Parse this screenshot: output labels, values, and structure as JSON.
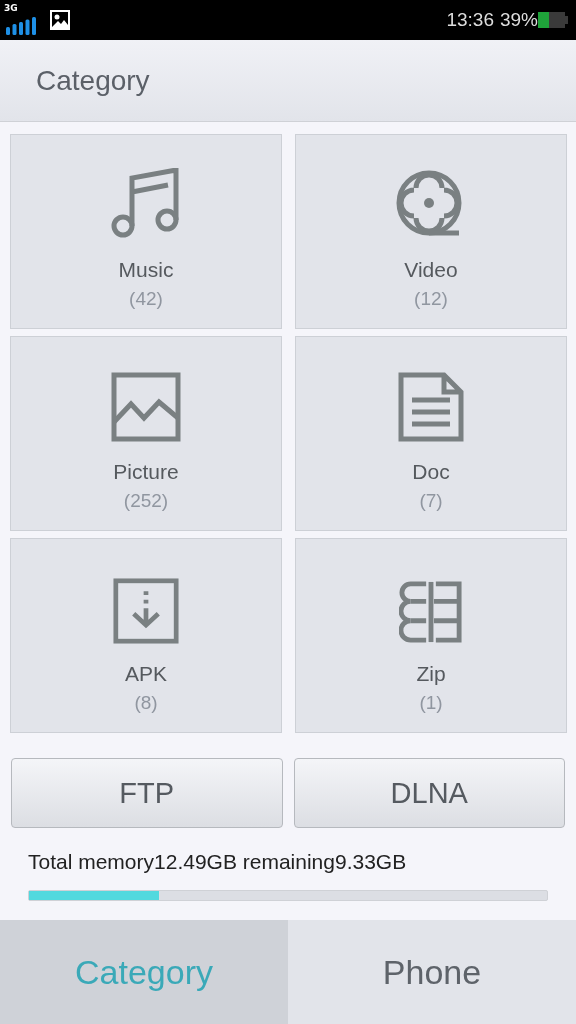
{
  "status_bar": {
    "network": "3G",
    "time": "13:36",
    "battery_text": "39%"
  },
  "header": {
    "title": "Category"
  },
  "categories": [
    {
      "kind": "music",
      "label": "Music",
      "count": "(42)"
    },
    {
      "kind": "video",
      "label": "Video",
      "count": "(12)"
    },
    {
      "kind": "picture",
      "label": "Picture",
      "count": "(252)"
    },
    {
      "kind": "doc",
      "label": "Doc",
      "count": "(7)"
    },
    {
      "kind": "apk",
      "label": "APK",
      "count": "(8)"
    },
    {
      "kind": "zip",
      "label": "Zip",
      "count": "(1)"
    }
  ],
  "buttons": [
    "FTP",
    "DLNA"
  ],
  "memory": {
    "text": "Total memory12.49GB  remaining9.33GB",
    "level": 0.25
  },
  "tabs": [
    {
      "label": "Category",
      "selected": true
    },
    {
      "label": "Phone",
      "selected": false
    }
  ]
}
